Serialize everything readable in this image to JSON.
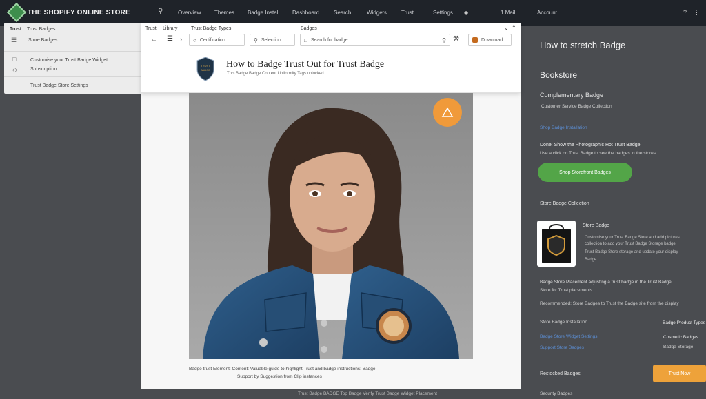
{
  "header": {
    "brand": "THE SHOPIFY ONLINE STORE",
    "search_icon": "search-icon",
    "nav": [
      "Overview",
      "Themes",
      "Badge Install",
      "Dashboard",
      "Search",
      "Widgets",
      "Trust",
      "Settings"
    ],
    "nav_right": [
      "1 Mail",
      "Account"
    ],
    "right_icons": [
      "help-icon",
      "more-icon"
    ]
  },
  "left_panel": {
    "header_left": "Trust",
    "header_right": "Trust Badges",
    "item_menu": "Store Badges",
    "item_one_line1": "Customise your Trust Badge Widget",
    "item_one_line2": "Subscription",
    "item_two": "Trust Badge Store Settings"
  },
  "modal": {
    "tab_left": "Trust",
    "tab_middle": "Library",
    "tab_extra": "Trust Badge Types",
    "tab_right": "Badges",
    "field_one": "Certification",
    "field_two": "Selection",
    "field_three": "Search for badge",
    "field_four": "Download",
    "title": "How to Badge Trust Out for Trust Badge",
    "subtitle": "This Badge Badge Content Uniformity Tags unlocked.",
    "badge_text_top": "TRUST",
    "badge_text_mid": "BADGE",
    "caption_line1": "Badge trust Element: Content: Valuable guide to highlight Trust and badge instructions: Badge",
    "caption_line2": "Support by Suggestion from Clip instances"
  },
  "sidebar": {
    "title": "How to stretch Badge",
    "section_title": "Bookstore",
    "sub_heading": "Complementary Badge",
    "sub_detail": "Customer Service Badge Collection",
    "link_one": "Shop Badge Installation",
    "promo_heading": "Done: Show the Photographic Hot Trust Badge",
    "promo_text": "Use a click on Trust Badge to see the badges in the stores",
    "green_button": "Shop Storefront Badges",
    "badge_section": "Store Badge Collection",
    "product_title": "Store Badge",
    "product_line1": "Customise your Trust Badge Store and add pictures",
    "product_line2": "collection to add your Trust Badge Storage badge",
    "product_line3": "Trust Badge Store storage and update your display",
    "product_line4": "Badge",
    "long_text1": "Badge Store Placement adjusting a trust badge in the Trust Badge",
    "long_text2": "Store for Trust placements",
    "long_text3": "Recommended: Store Badges to Trust the Badge site from the display",
    "row1_left": "Store Badge Installation",
    "row1_right": "Badge Product Types",
    "row2_left": "Badge Store Widget Settings",
    "row2_right": "Cosmetic Badges",
    "row3_left": "Support Store Badges",
    "row3_right": "Badge Storage",
    "bottom_left": "Restocked Badges",
    "orange_button": "Trust Now",
    "bottom_link": "Security Badges"
  },
  "footer": {
    "text": "Trust Badge BADGE Top Badge Verify Trust Badge Widget Placement"
  },
  "colors": {
    "topbar": "#1f2329",
    "background": "#4a4c50",
    "green": "#53a548",
    "orange": "#eea23a",
    "link": "#5c8fd6"
  }
}
